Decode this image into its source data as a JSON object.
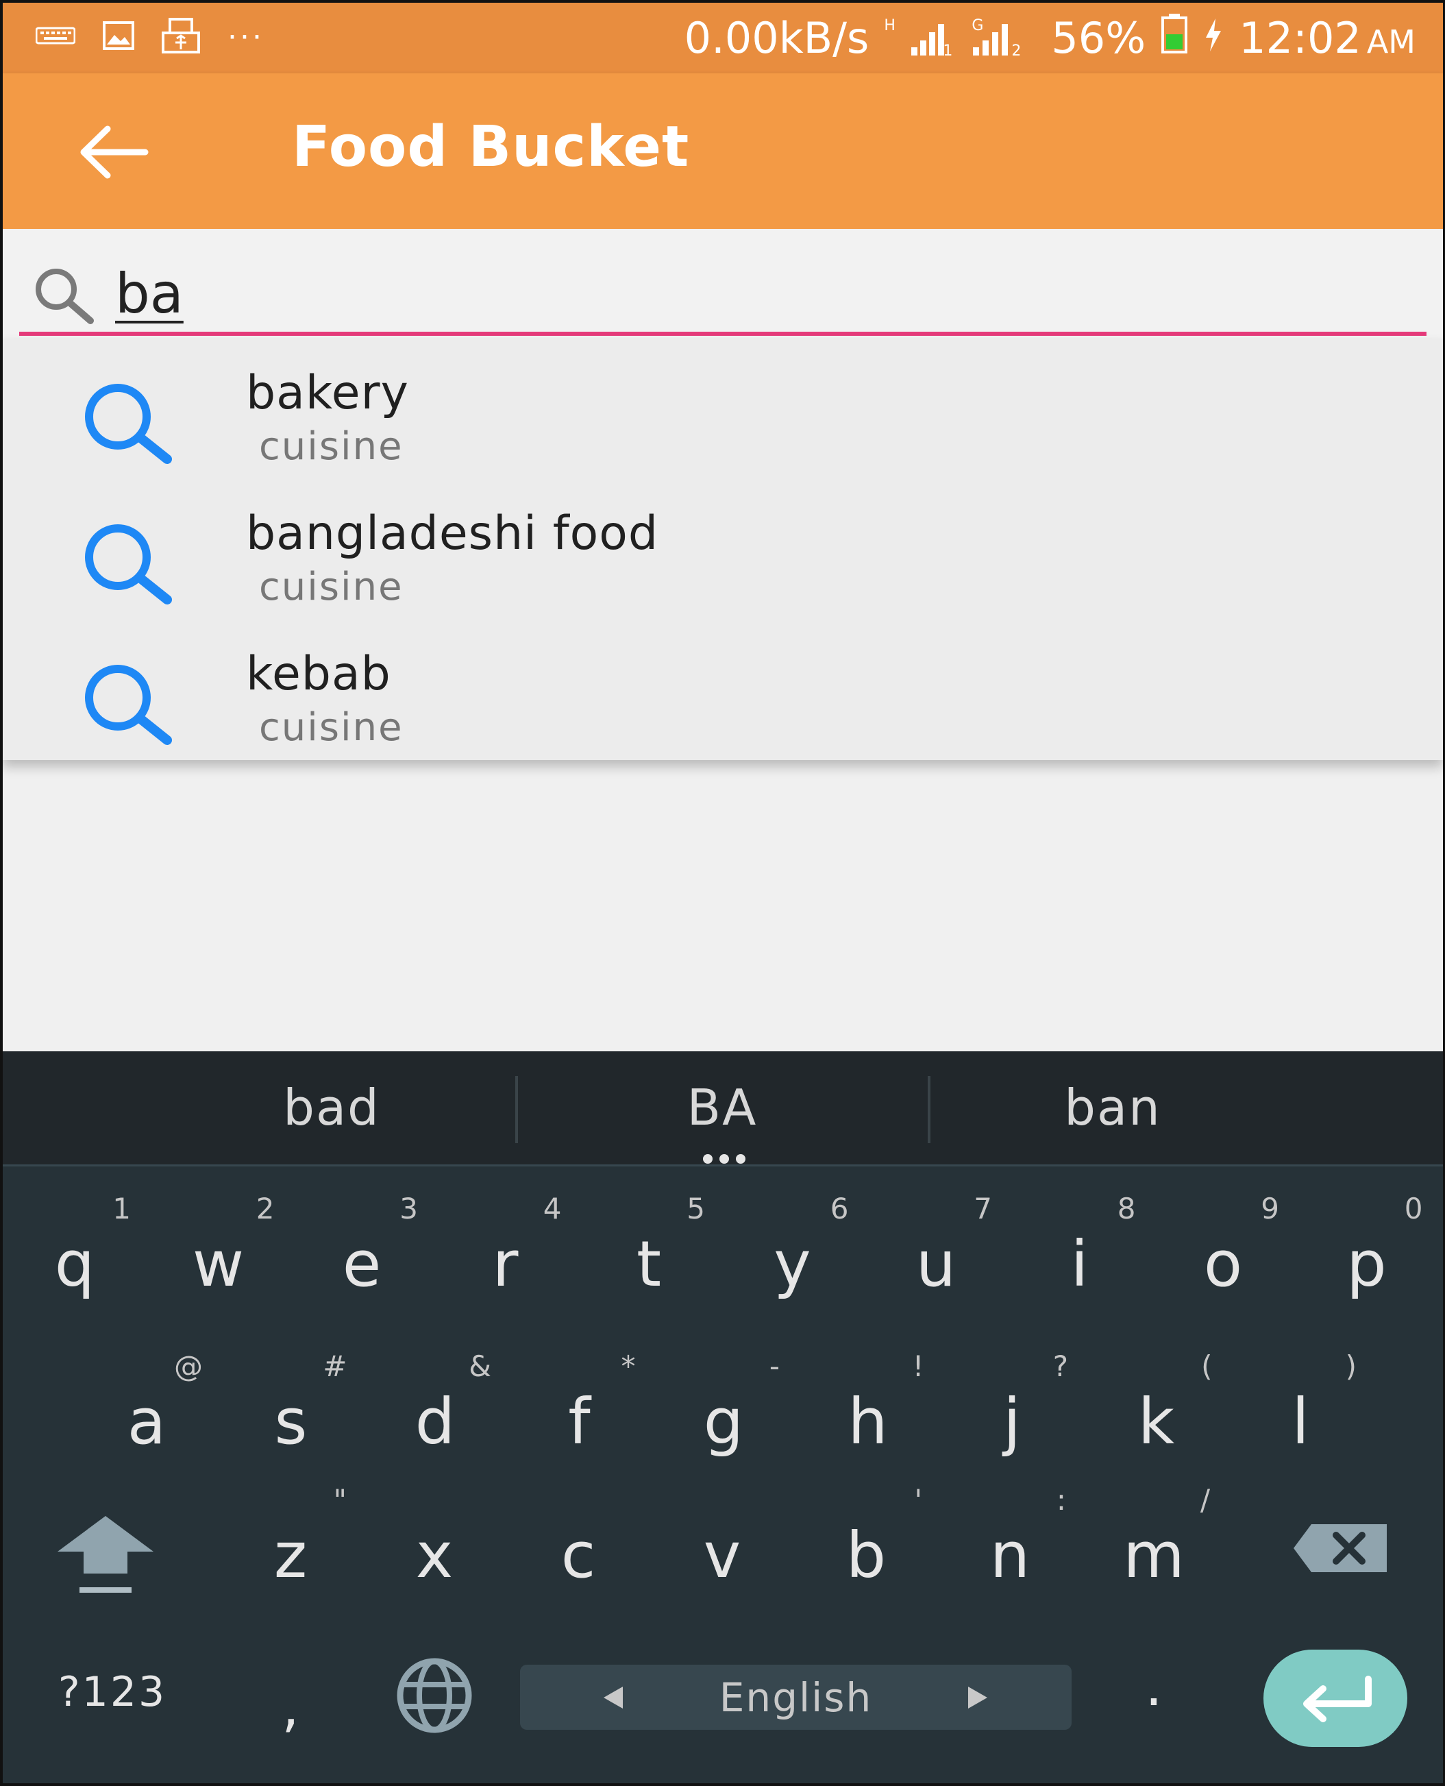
{
  "status_bar": {
    "icons": [
      "keyboard-icon",
      "image-icon",
      "usb-icon",
      "more-icon"
    ],
    "data_rate": "0.00kB/s",
    "network_1_type": "H",
    "network_1_sub": "1",
    "network_2_type": "G",
    "network_2_sub": "2",
    "battery_percent": "56%",
    "time": "12:02",
    "ampm": "AM"
  },
  "app_bar": {
    "title": "Food Bucket",
    "color": "#f39a45"
  },
  "search": {
    "value": "ba",
    "underline_color": "#e53a7a"
  },
  "suggestions": [
    {
      "title": "bakery",
      "subtitle": "cuisine"
    },
    {
      "title": "bangladeshi food",
      "subtitle": "cuisine"
    },
    {
      "title": "kebab",
      "subtitle": "cuisine"
    }
  ],
  "keyboard": {
    "word_suggestions": [
      "bad",
      "BA",
      "ban"
    ],
    "row1": [
      {
        "key": "q",
        "hint": "1"
      },
      {
        "key": "w",
        "hint": "2"
      },
      {
        "key": "e",
        "hint": "3"
      },
      {
        "key": "r",
        "hint": "4"
      },
      {
        "key": "t",
        "hint": "5"
      },
      {
        "key": "y",
        "hint": "6"
      },
      {
        "key": "u",
        "hint": "7"
      },
      {
        "key": "i",
        "hint": "8"
      },
      {
        "key": "o",
        "hint": "9"
      },
      {
        "key": "p",
        "hint": "0"
      }
    ],
    "row2": [
      {
        "key": "a",
        "hint": "@"
      },
      {
        "key": "s",
        "hint": "#"
      },
      {
        "key": "d",
        "hint": "&"
      },
      {
        "key": "f",
        "hint": "*"
      },
      {
        "key": "g",
        "hint": "-"
      },
      {
        "key": "h",
        "hint": "!"
      },
      {
        "key": "j",
        "hint": "?"
      },
      {
        "key": "k",
        "hint": "("
      },
      {
        "key": "l",
        "hint": ")"
      }
    ],
    "row3": [
      {
        "key": "z",
        "hint": "\""
      },
      {
        "key": "x",
        "hint": ""
      },
      {
        "key": "c",
        "hint": ""
      },
      {
        "key": "v",
        "hint": ""
      },
      {
        "key": "b",
        "hint": "'"
      },
      {
        "key": "n",
        "hint": ":"
      },
      {
        "key": "m",
        "hint": "/"
      }
    ],
    "symbols_key": "?123",
    "comma_key": ",",
    "period_key": ".",
    "language_label": "English",
    "enter_color": "#80cbc4"
  }
}
